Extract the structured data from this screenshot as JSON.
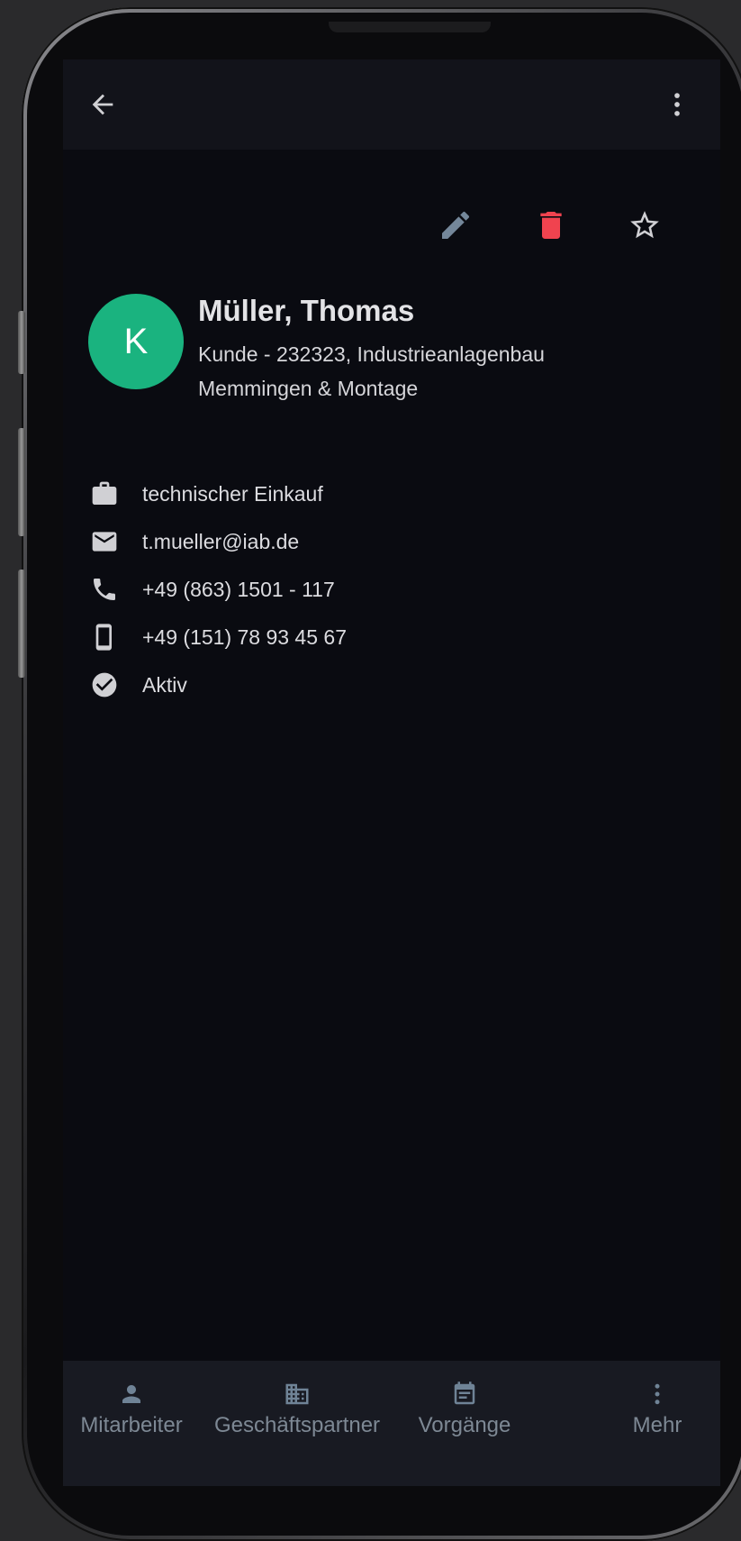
{
  "colors": {
    "avatar_bg": "#1ab37f",
    "delete_red": "#f0434f",
    "edit_blue": "#74879a",
    "nav_text": "#7d8894"
  },
  "appbar": {
    "back_icon": "arrow-back-icon",
    "menu_icon": "more-vert-icon"
  },
  "actions": {
    "edit_icon": "pencil-icon",
    "delete_icon": "trash-icon",
    "favorite_icon": "star-outline-icon"
  },
  "contact": {
    "avatar_initial": "K",
    "name": "Müller, Thomas",
    "subtitle": "Kunde - 232323, Industrieanlagenbau Memmingen & Montage"
  },
  "details": [
    {
      "icon": "briefcase-icon",
      "text": "technischer Einkauf"
    },
    {
      "icon": "mail-icon",
      "text": "t.mueller@iab.de"
    },
    {
      "icon": "phone-icon",
      "text": "+49 (863) 1501 - 117"
    },
    {
      "icon": "mobile-icon",
      "text": "+49 (151) 78 93 45 67"
    },
    {
      "icon": "check-circle-icon",
      "text": "Aktiv"
    }
  ],
  "nav": [
    {
      "icon": "person-icon",
      "label": "Mitarbeiter"
    },
    {
      "icon": "building-icon",
      "label": "Geschäftspartner"
    },
    {
      "icon": "calendar-icon",
      "label": "Vorgänge"
    },
    {
      "icon": "more-vert-icon",
      "label": "Mehr"
    }
  ]
}
